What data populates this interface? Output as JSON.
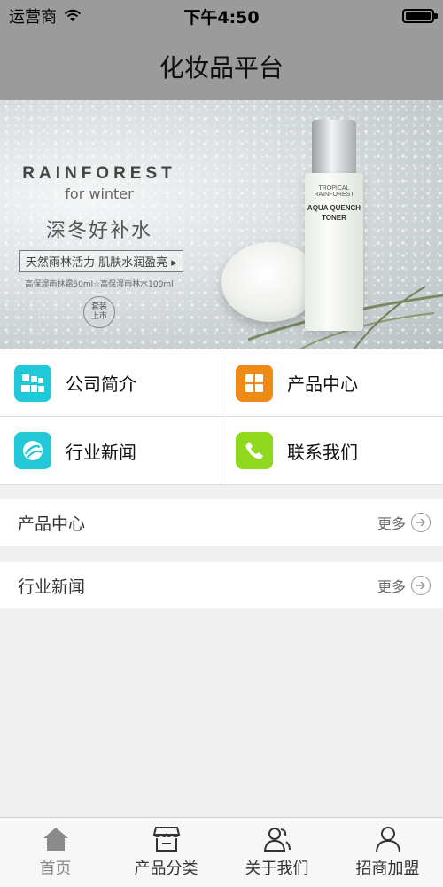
{
  "status_bar": {
    "carrier": "运营商",
    "time": "下午4:50"
  },
  "header": {
    "title": "化妆品平台"
  },
  "banner": {
    "brand": "RAINFOREST",
    "brand_sub": "for winter",
    "slogan": "深冬好补水",
    "tagline": "天然雨林活力 肌肤水润盈亮 ▸",
    "fineprint": "高保湿雨林霜50ml☆高保湿雨林水100ml",
    "badge_line1": "套装",
    "badge_line2": "上市",
    "bottle_label_top": "TROPICAL RAINFOREST",
    "bottle_label_main": "AQUA QUENCH TONER"
  },
  "menu": [
    {
      "label": "公司简介",
      "icon": "company-icon",
      "color": "#20c8d8"
    },
    {
      "label": "产品中心",
      "icon": "grid-icon",
      "color": "#f08a16"
    },
    {
      "label": "行业新闻",
      "icon": "news-icon",
      "color": "#20c8d8"
    },
    {
      "label": "联系我们",
      "icon": "phone-icon",
      "color": "#8fd81e"
    }
  ],
  "sections": [
    {
      "title": "产品中心",
      "more": "更多"
    },
    {
      "title": "行业新闻",
      "more": "更多"
    }
  ],
  "tabs": [
    {
      "label": "首页",
      "icon": "home-icon"
    },
    {
      "label": "产品分类",
      "icon": "store-icon"
    },
    {
      "label": "关于我们",
      "icon": "people-icon"
    },
    {
      "label": "招商加盟",
      "icon": "user-icon"
    }
  ]
}
